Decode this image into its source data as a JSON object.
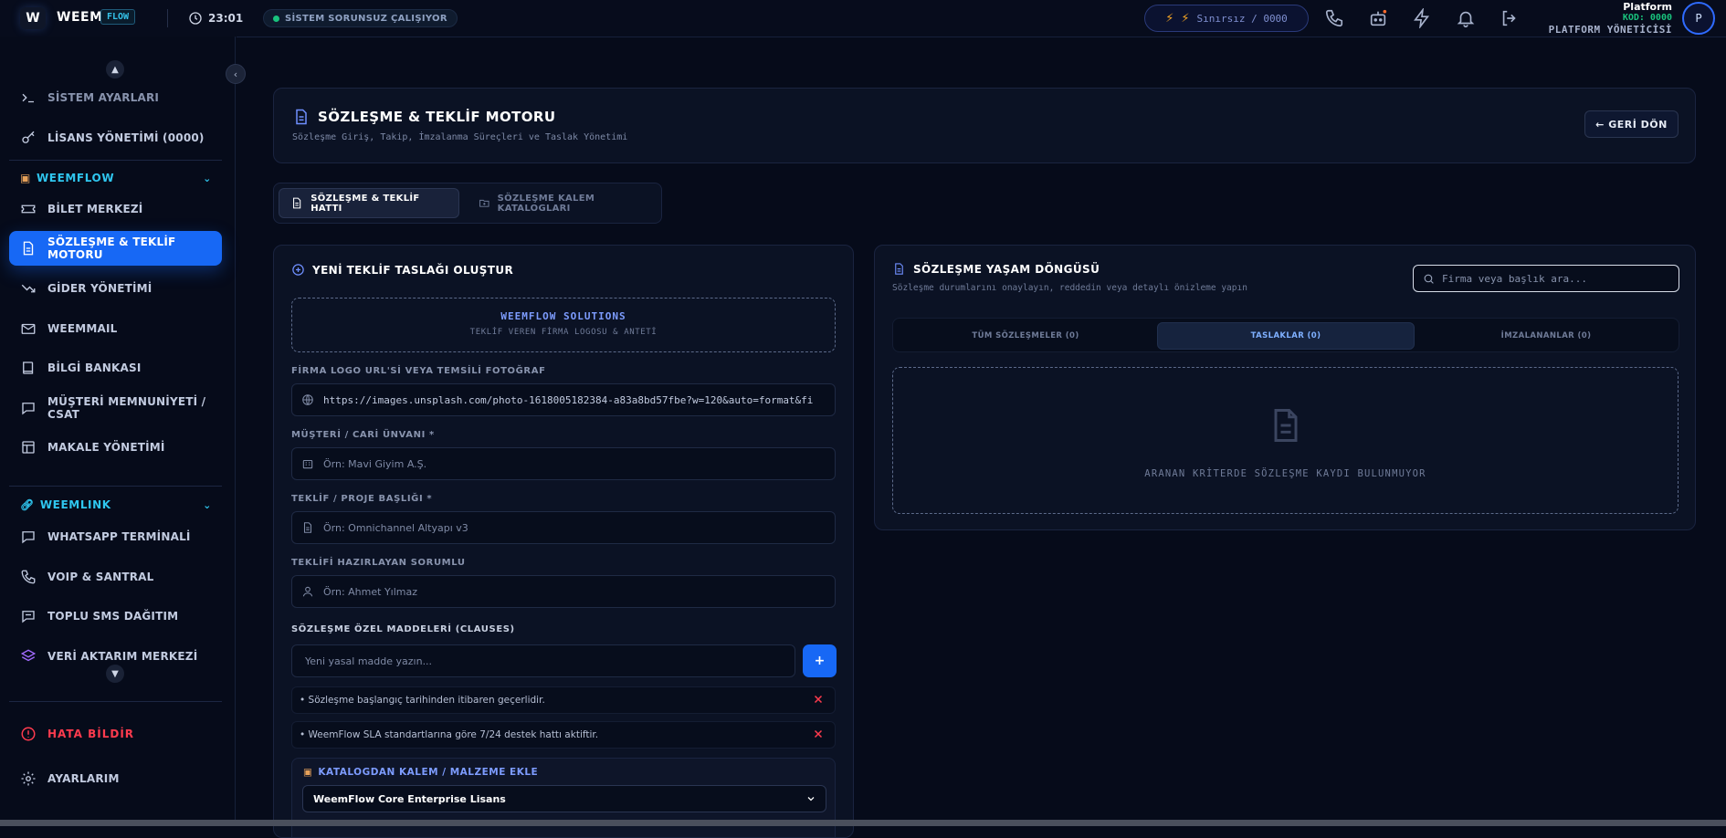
{
  "topbar": {
    "logo_letter": "W",
    "brand": "WEEM",
    "brand_tag": "FLOW",
    "time": "23:01",
    "status": "SİSTEM SORUNSUZ ÇALIŞIYOR",
    "credit": "Sınırsız / 0000",
    "user_name": "Platform",
    "user_code": "KOD: 0000",
    "user_role": "PLATFORM YÖNETİCİSİ",
    "avatar": "P",
    "icons": [
      "phone-icon",
      "robot-icon",
      "bolt-icon",
      "bell-icon",
      "logout-icon"
    ]
  },
  "sidebar": {
    "top_items": [
      {
        "label": "SİSTEM AYARLARI",
        "icon": "terminal-icon"
      },
      {
        "label": "LİSANS YÖNETİMİ (0000)",
        "icon": "key-icon"
      }
    ],
    "weemflow_header": "WEEMFLOW",
    "weemflow_items": [
      {
        "label": "BİLET MERKEZİ",
        "icon": "ticket-icon"
      },
      {
        "label": "SÖZLEŞME & TEKLİF MOTORU",
        "icon": "document-icon",
        "active": true
      },
      {
        "label": "GİDER YÖNETİMİ",
        "icon": "trend-down-icon"
      },
      {
        "label": "WEEMMAIL",
        "icon": "mail-icon"
      },
      {
        "label": "BİLGİ BANKASI",
        "icon": "book-icon"
      },
      {
        "label": "MÜŞTERİ MEMNUNİYETİ / CSAT",
        "icon": "chat-icon"
      },
      {
        "label": "MAKALE YÖNETİMİ",
        "icon": "layout-icon"
      }
    ],
    "weemlink_header": "WEEMLINK",
    "weemlink_items": [
      {
        "label": "WHATSAPP TERMİNALİ",
        "icon": "chat-icon"
      },
      {
        "label": "VOIP & SANTRAL",
        "icon": "phone-icon"
      },
      {
        "label": "TOPLU SMS DAĞITIM",
        "icon": "message-icon"
      },
      {
        "label": "VERİ AKTARIM MERKEZİ",
        "icon": "layers-icon"
      }
    ],
    "report_error": "HATA BİLDİR",
    "settings": "AYARLARIM"
  },
  "header": {
    "title": "SÖZLEŞME & TEKLİF MOTORU",
    "subtitle": "Sözleşme Giriş, Takip, İmzalanma Süreçleri ve Taslak Yönetimi",
    "back_label": "← GERİ DÖN"
  },
  "tabs": [
    {
      "label": "SÖZLEŞME & TEKLİF HATTI",
      "active": true
    },
    {
      "label": "SÖZLEŞME KALEM KATALOGLARI",
      "active": false
    }
  ],
  "form": {
    "title": "YENİ TEKLİF TASLAĞI OLUŞTUR",
    "brand_name": "WEEMFLOW SOLUTIONS",
    "brand_caption": "TEKLİF VEREN FİRMA LOGOSU & ANTETİ",
    "logo_label": "FİRMA LOGO URL'Sİ VEYA TEMSİLİ FOTOĞRAF",
    "logo_value": "https://images.unsplash.com/photo-1618005182384-a83a8bd57fbe?w=120&auto=format&fi",
    "customer_label": "MÜŞTERİ / CARİ ÜNVANI *",
    "customer_placeholder": "Örn: Mavi Giyim A.Ş.",
    "project_label": "TEKLİF / PROJE BAŞLIĞI *",
    "project_placeholder": "Örn: Omnichannel Altyapı v3",
    "owner_label": "TEKLİFİ HAZIRLAYAN SORUMLU",
    "owner_placeholder": "Örn: Ahmet Yılmaz",
    "clauses_label": "SÖZLEŞME ÖZEL MADDELERİ (CLAUSES)",
    "clause_placeholder": "Yeni yasal madde yazın...",
    "add_label": "+",
    "clauses": [
      "• Sözleşme başlangıç tarihinden itibaren geçerlidir.",
      "• WeemFlow SLA standartlarına göre 7/24 destek hattı aktiftir."
    ],
    "catalog_title": "KATALOGDAN KALEM / MALZEME EKLE",
    "catalog_selected": "WeemFlow Core Enterprise Lisans"
  },
  "lifecycle": {
    "title": "SÖZLEŞME YAŞAM DÖNGÜSÜ",
    "subtitle": "Sözleşme durumlarını onaylayın, reddedin veya detaylı önizleme yapın",
    "search_placeholder": "Firma veya başlık ara...",
    "tabs": [
      {
        "label": "TÜM SÖZLEŞMELER (0)",
        "active": false
      },
      {
        "label": "TASLAKLAR (0)",
        "active": true
      },
      {
        "label": "İMZALANANLAR (0)",
        "active": false
      }
    ],
    "empty_text": "ARANAN KRİTERDE SÖZLEŞME KAYDI BULUNMUYOR"
  }
}
